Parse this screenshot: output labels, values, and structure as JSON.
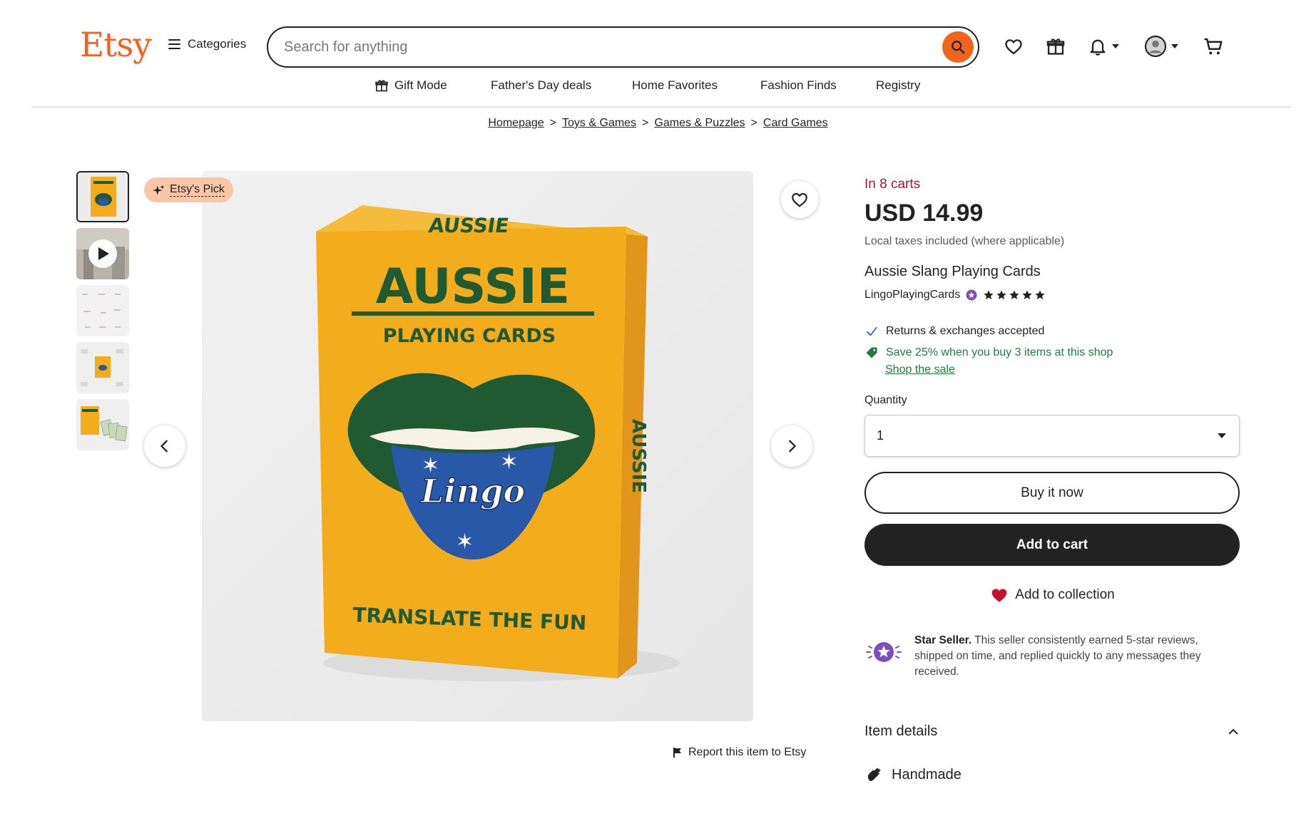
{
  "header": {
    "logo": "Etsy",
    "categories_label": "Categories",
    "search_placeholder": "Search for anything"
  },
  "nav": [
    {
      "label": "Gift Mode"
    },
    {
      "label": "Father's Day deals"
    },
    {
      "label": "Home Favorites"
    },
    {
      "label": "Fashion Finds"
    },
    {
      "label": "Registry"
    }
  ],
  "breadcrumb": [
    "Homepage",
    "Toys & Games",
    "Games & Puzzles",
    "Card Games"
  ],
  "gallery": {
    "badge": "Etsy's Pick",
    "report_label": "Report this item to Etsy",
    "box_title": "AUSSIE",
    "box_subtitle": "PLAYING CARDS",
    "box_brand": "Lingo",
    "box_tagline": "TRANSLATE THE FUN",
    "box_side": "AUSSIE"
  },
  "listing": {
    "in_carts": "In 8 carts",
    "price": "USD 14.99",
    "taxes_note": "Local taxes included (where applicable)",
    "title": "Aussie Slang Playing Cards",
    "shop_name": "LingoPlayingCards",
    "rating_stars": 5,
    "returns": "Returns & exchanges accepted",
    "sale_text": "Save 25% when you buy 3 items at this shop",
    "sale_link": "Shop the sale",
    "quantity_label": "Quantity",
    "quantity_value": "1",
    "buy_now": "Buy it now",
    "add_to_cart": "Add to cart",
    "add_to_collection": "Add to collection",
    "star_seller_title": "Star Seller.",
    "star_seller_text": "This seller consistently earned 5-star reviews, shipped on time, and replied quickly to any messages they received.",
    "item_details": "Item details",
    "handmade": "Handmade"
  },
  "colors": {
    "brand": "#f1641e",
    "in_carts": "#a61a2e",
    "sale_green": "#227a3f",
    "box_yellow": "#f3ad1c",
    "box_green": "#1f5a32",
    "box_blue": "#2a58a8"
  }
}
